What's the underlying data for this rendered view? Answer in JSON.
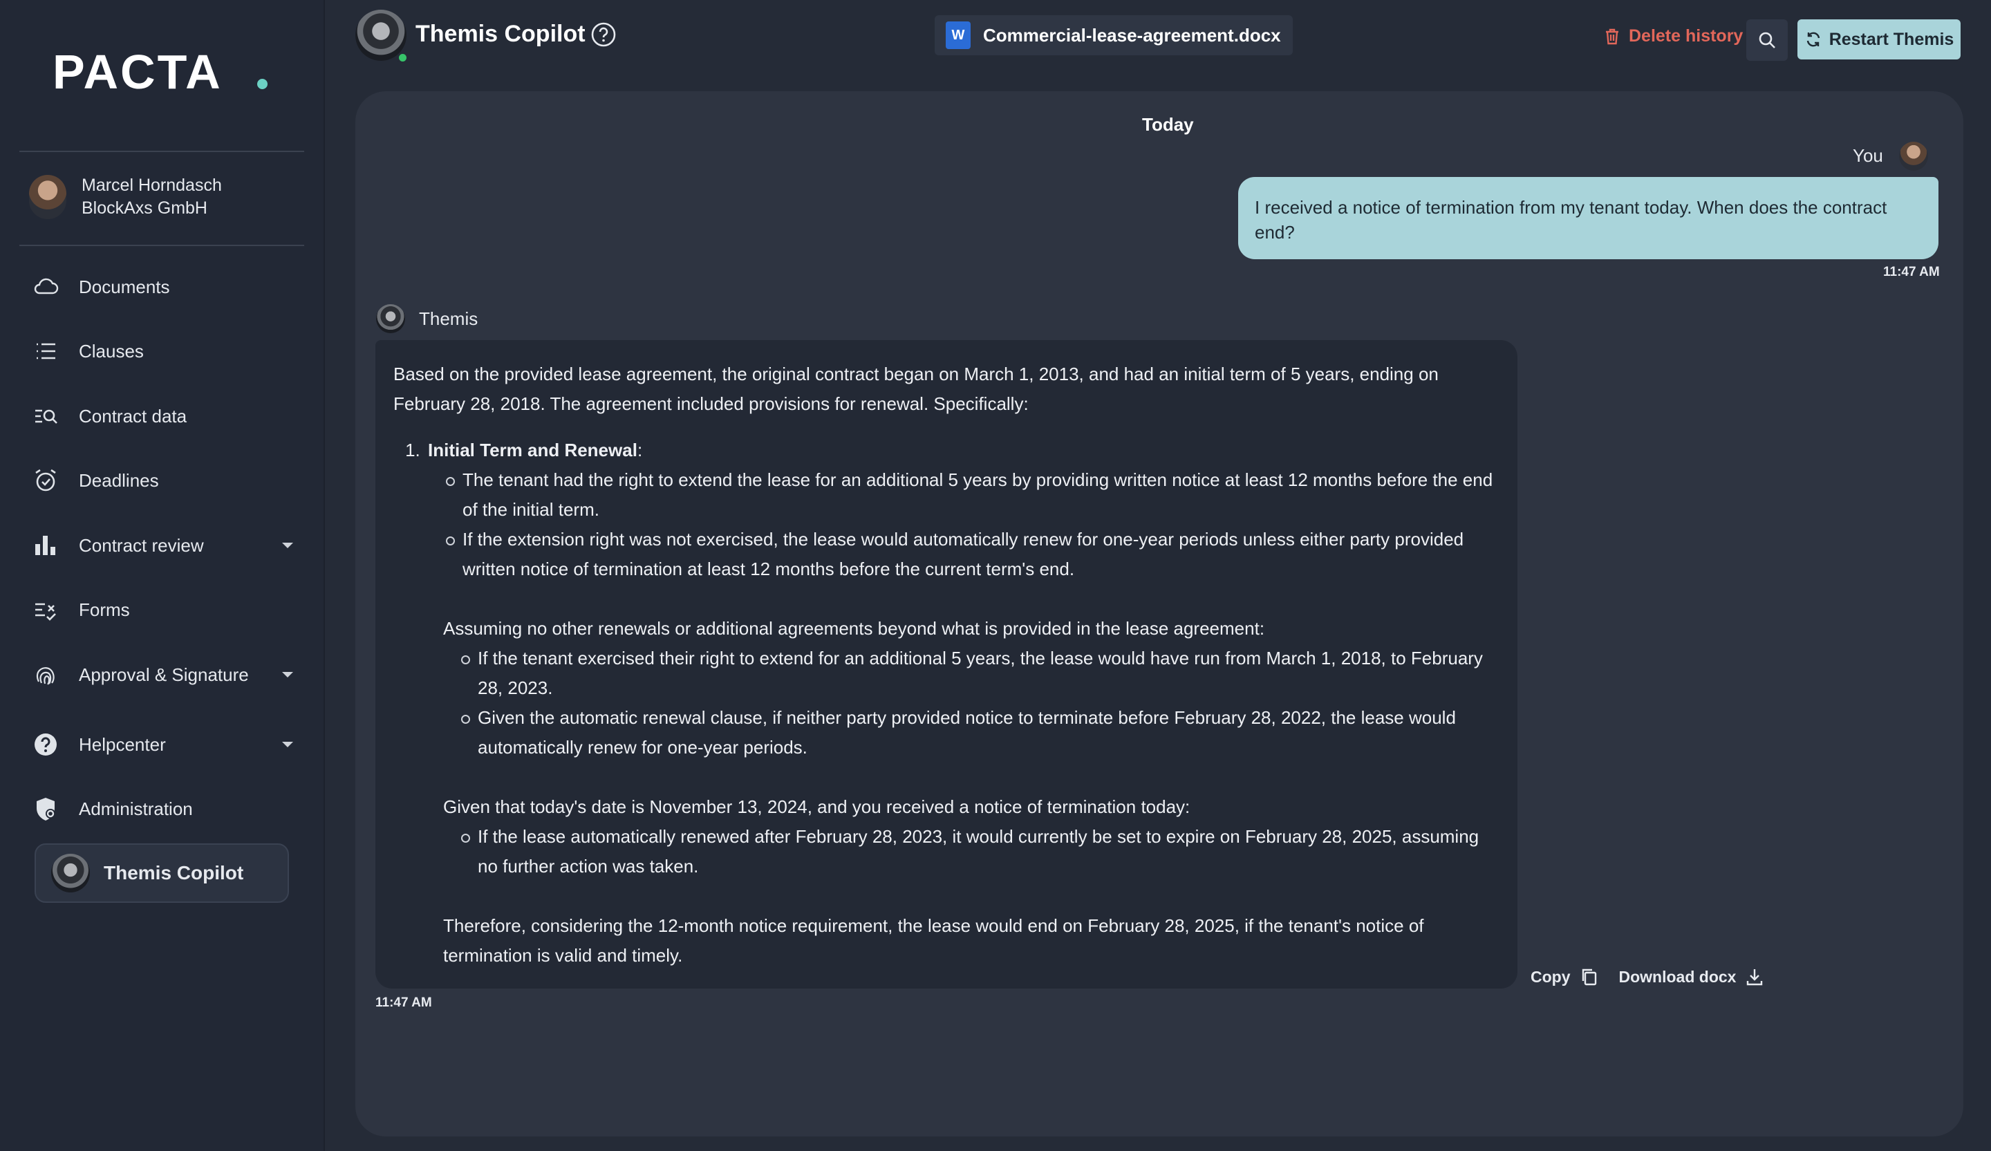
{
  "sidebar": {
    "logo": "PACTA",
    "user": {
      "name": "Marcel Horndasch",
      "company": "BlockAxs GmbH"
    },
    "items": [
      {
        "label": "Documents",
        "icon": "cloud-icon"
      },
      {
        "label": "Clauses",
        "icon": "list-icon"
      },
      {
        "label": "Contract data",
        "icon": "search-list-icon"
      },
      {
        "label": "Deadlines",
        "icon": "alarm-clock-icon"
      },
      {
        "label": "Contract review",
        "icon": "bar-chart-icon",
        "expandable": true
      },
      {
        "label": "Forms",
        "icon": "form-check-icon"
      },
      {
        "label": "Approval & Signature",
        "icon": "fingerprint-icon",
        "expandable": true
      },
      {
        "label": "Helpcenter",
        "icon": "help-circle-icon",
        "expandable": true
      },
      {
        "label": "Administration",
        "icon": "shield-gear-icon"
      }
    ],
    "copilot_label": "Themis Copilot"
  },
  "header": {
    "title": "Themis Copilot",
    "file_name": "Commercial-lease-agreement.docx",
    "file_icon_letter": "W",
    "delete_label": "Delete history",
    "restart_label": "Restart Themis"
  },
  "chat": {
    "date_separator": "Today",
    "user_name": "You",
    "user_message": "I received a notice of termination from my tenant today. When does the contract end?",
    "user_time": "11:47 AM",
    "bot_name": "Themis",
    "bot_time": "11:47 AM",
    "bot": {
      "intro": "Based on the provided lease agreement, the original contract began on March 1, 2013, and had an initial term of 5 years, ending on February 28, 2018. The agreement included provisions for renewal. Specifically:",
      "section_title": "Initial Term and Renewal",
      "section_suffix": ":",
      "section_bullets": [
        "The tenant had the right to extend the lease for an additional 5 years by providing written notice at least 12 months before the end of the initial term.",
        "If the extension right was not exercised, the lease would automatically renew for one-year periods unless either party provided written notice of termination at least 12 months before the current term's end."
      ],
      "assume_text": "Assuming no other renewals or additional agreements beyond what is provided in the lease agreement:",
      "assume_bullets": [
        "If the tenant exercised their right to extend for an additional 5 years, the lease would have run from March 1, 2018, to February 28, 2023.",
        "Given the automatic renewal clause, if neither party provided notice to terminate before February 28, 2022, the lease would automatically renew for one-year periods."
      ],
      "given_text": "Given that today's date is November 13, 2024, and you received a notice of termination today:",
      "given_bullets": [
        "If the lease automatically renewed after February 28, 2023, it would currently be set to expire on February 28, 2025, assuming no further action was taken."
      ],
      "conclusion": "Therefore, considering the 12-month notice requirement, the lease would end on February 28, 2025, if the tenant's notice of termination is valid and timely."
    },
    "actions": {
      "copy": "Copy",
      "download": "Download docx"
    }
  },
  "colors": {
    "accent": "#a9d4da",
    "danger": "#e2675a",
    "online": "#37c46a",
    "logo_dot": "#6cd1c4"
  }
}
